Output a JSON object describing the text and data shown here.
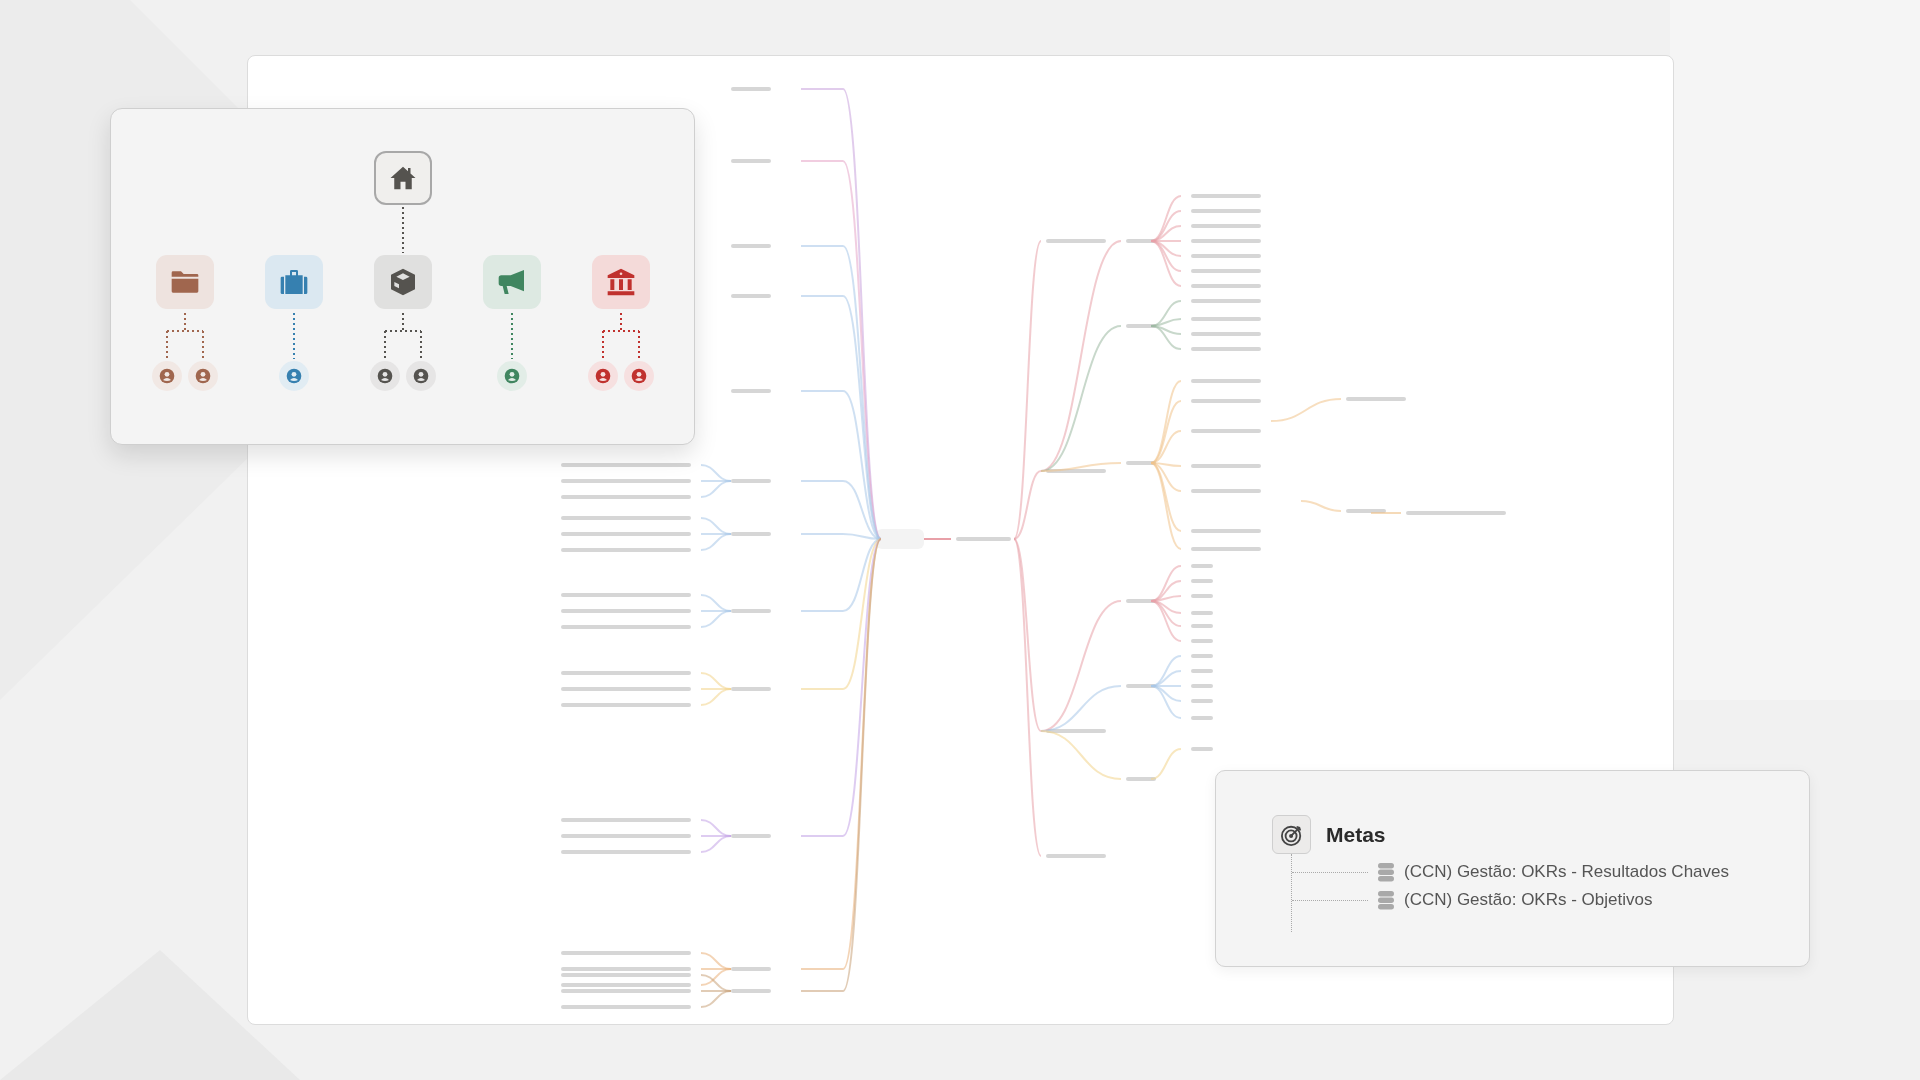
{
  "org_chart": {
    "root": {
      "kind": "house"
    },
    "departments": [
      {
        "kind": "folder",
        "color": "#a0664e",
        "members": [
          {
            "kind": "person"
          },
          {
            "kind": "person"
          }
        ]
      },
      {
        "kind": "briefcase",
        "color": "#3680b0",
        "members": [
          {
            "kind": "person"
          }
        ]
      },
      {
        "kind": "box",
        "color": "#55534f",
        "members": [
          {
            "kind": "person"
          },
          {
            "kind": "person"
          }
        ]
      },
      {
        "kind": "megaphone",
        "color": "#408660",
        "members": [
          {
            "kind": "person"
          }
        ]
      },
      {
        "kind": "bank",
        "color": "#c0312e",
        "members": [
          {
            "kind": "person"
          },
          {
            "kind": "person"
          }
        ]
      }
    ]
  },
  "goals_card": {
    "title": "Metas",
    "items": [
      {
        "label": "(CCN) Gestão: OKRs - Resultados Chaves"
      },
      {
        "label": "(CCN) Gestão: OKRs - Objetivos"
      }
    ]
  }
}
